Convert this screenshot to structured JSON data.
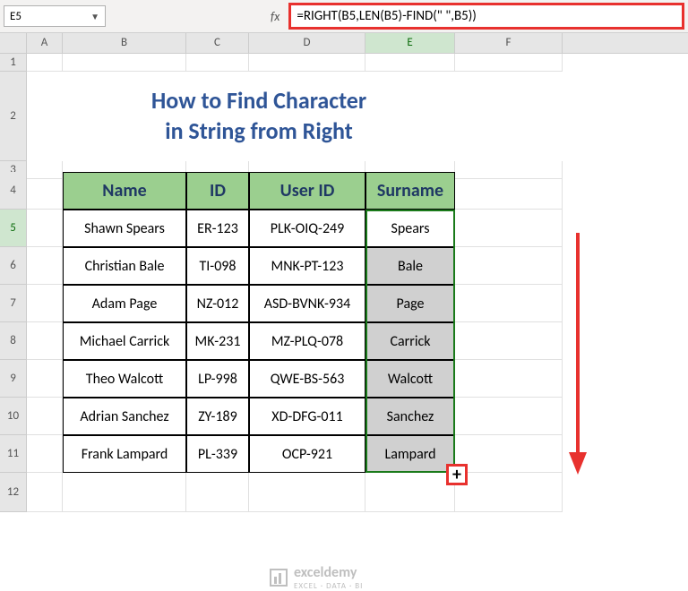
{
  "namebox": "E5",
  "formula": "=RIGHT(B5,LEN(B5)-FIND(\" \",B5))",
  "columns": [
    "",
    "A",
    "B",
    "C",
    "D",
    "E",
    "F"
  ],
  "active_column_index": 5,
  "title": {
    "line1": "How to Find Character",
    "line2": "in String from Right"
  },
  "headers": {
    "name": "Name",
    "id": "ID",
    "userid": "User ID",
    "surname": "Surname"
  },
  "rows": [
    {
      "n": "5",
      "name": "Shawn Spears",
      "id": "ER-123",
      "userid": "PLK-OIQ-249",
      "surname": "Spears"
    },
    {
      "n": "6",
      "name": "Christian Bale",
      "id": "TI-098",
      "userid": "MNK-PT-123",
      "surname": "Bale"
    },
    {
      "n": "7",
      "name": "Adam Page",
      "id": "NZ-012",
      "userid": "ASD-BVNK-934",
      "surname": "Page"
    },
    {
      "n": "8",
      "name": "Michael Carrick",
      "id": "MK-231",
      "userid": "MZ-PLQ-078",
      "surname": "Carrick"
    },
    {
      "n": "9",
      "name": "Theo Walcott",
      "id": "LP-998",
      "userid": "QWE-BS-563",
      "surname": "Walcott"
    },
    {
      "n": "10",
      "name": "Adrian Sanchez",
      "id": "ZY-189",
      "userid": "XD-DFG-011",
      "surname": "Sanchez"
    },
    {
      "n": "11",
      "name": "Frank Lampard",
      "id": "PL-339",
      "userid": "OCP-921",
      "surname": "Lampard"
    }
  ],
  "pre_rows": [
    "1",
    "2",
    "3",
    "4"
  ],
  "post_row": "12",
  "watermark": {
    "brand": "exceldemy",
    "tag": "EXCEL · DATA · BI"
  },
  "chart_data": {
    "type": "table",
    "title": "How to Find Character in String from Right",
    "columns": [
      "Name",
      "ID",
      "User ID",
      "Surname"
    ],
    "data": [
      [
        "Shawn Spears",
        "ER-123",
        "PLK-OIQ-249",
        "Spears"
      ],
      [
        "Christian Bale",
        "TI-098",
        "MNK-PT-123",
        "Bale"
      ],
      [
        "Adam Page",
        "NZ-012",
        "ASD-BVNK-934",
        "Page"
      ],
      [
        "Michael Carrick",
        "MK-231",
        "MZ-PLQ-078",
        "Carrick"
      ],
      [
        "Theo Walcott",
        "LP-998",
        "QWE-BS-563",
        "Walcott"
      ],
      [
        "Adrian Sanchez",
        "ZY-189",
        "XD-DFG-011",
        "Sanchez"
      ],
      [
        "Frank Lampard",
        "PL-339",
        "OCP-921",
        "Lampard"
      ]
    ]
  }
}
